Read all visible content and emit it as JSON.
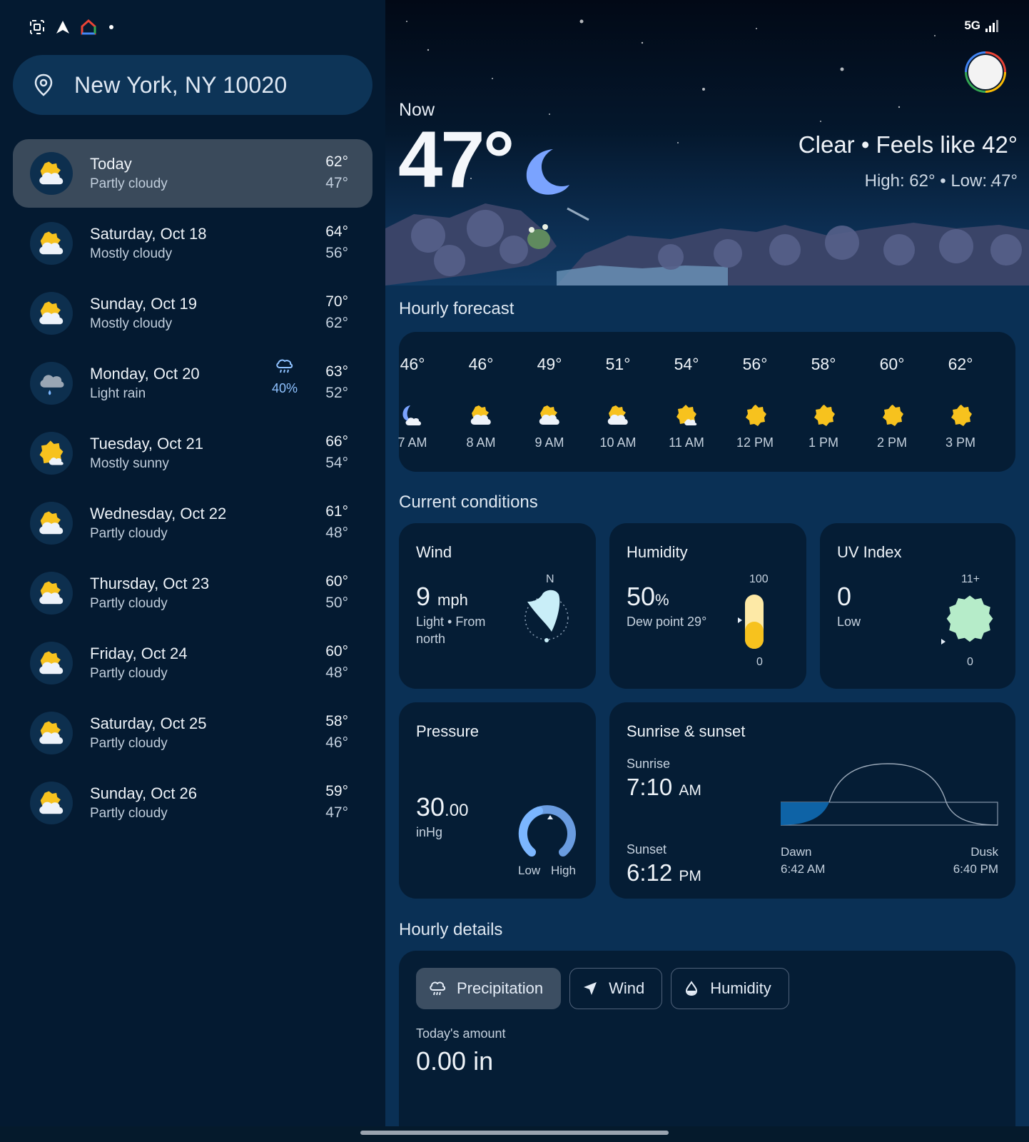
{
  "search": {
    "location": "New York, NY 10020"
  },
  "daily": [
    {
      "name": "Today",
      "cond": "Partly cloudy",
      "hi": "62°",
      "lo": "47°",
      "icon": "partly-cloudy-icon"
    },
    {
      "name": "Saturday, Oct 18",
      "cond": "Mostly cloudy",
      "hi": "64°",
      "lo": "56°",
      "icon": "mostly-cloudy-icon"
    },
    {
      "name": "Sunday, Oct 19",
      "cond": "Mostly cloudy",
      "hi": "70°",
      "lo": "62°",
      "icon": "mostly-cloudy-icon"
    },
    {
      "name": "Monday, Oct 20",
      "cond": "Light rain",
      "hi": "63°",
      "lo": "52°",
      "icon": "light-rain-icon",
      "rain": "40%"
    },
    {
      "name": "Tuesday, Oct 21",
      "cond": "Mostly sunny",
      "hi": "66°",
      "lo": "54°",
      "icon": "mostly-sunny-icon"
    },
    {
      "name": "Wednesday, Oct 22",
      "cond": "Partly cloudy",
      "hi": "61°",
      "lo": "48°",
      "icon": "partly-cloudy-icon"
    },
    {
      "name": "Thursday, Oct 23",
      "cond": "Partly cloudy",
      "hi": "60°",
      "lo": "50°",
      "icon": "partly-cloudy-icon"
    },
    {
      "name": "Friday, Oct 24",
      "cond": "Partly cloudy",
      "hi": "60°",
      "lo": "48°",
      "icon": "partly-cloudy-icon"
    },
    {
      "name": "Saturday, Oct 25",
      "cond": "Partly cloudy",
      "hi": "58°",
      "lo": "46°",
      "icon": "partly-cloudy-icon"
    },
    {
      "name": "Sunday, Oct 26",
      "cond": "Partly cloudy",
      "hi": "59°",
      "lo": "47°",
      "icon": "partly-cloudy-icon"
    }
  ],
  "status": {
    "network": "5G"
  },
  "now": {
    "label": "Now",
    "temp": "47°",
    "cond_line": "Clear • Feels like 42°",
    "hilo_line": "High: 62° • Low: 47°"
  },
  "sections": {
    "hourly": "Hourly forecast",
    "current": "Current conditions",
    "hourly_details": "Hourly details"
  },
  "hourly": [
    {
      "temp": "46°",
      "time": "7 AM",
      "icon": "moon-cloud-icon"
    },
    {
      "temp": "46°",
      "time": "8 AM",
      "icon": "partly-cloudy-icon"
    },
    {
      "temp": "49°",
      "time": "9 AM",
      "icon": "partly-cloudy-icon"
    },
    {
      "temp": "51°",
      "time": "10 AM",
      "icon": "partly-cloudy-icon"
    },
    {
      "temp": "54°",
      "time": "11 AM",
      "icon": "mostly-sunny-icon"
    },
    {
      "temp": "56°",
      "time": "12 PM",
      "icon": "sun-icon"
    },
    {
      "temp": "58°",
      "time": "1 PM",
      "icon": "sun-icon"
    },
    {
      "temp": "60°",
      "time": "2 PM",
      "icon": "sun-icon"
    },
    {
      "temp": "62°",
      "time": "3 PM",
      "icon": "sun-icon"
    }
  ],
  "wind": {
    "title": "Wind",
    "value": "9",
    "unit": "mph",
    "desc1": "Light • From",
    "desc2": "north",
    "dir_label": "N"
  },
  "humidity": {
    "title": "Humidity",
    "value": "50",
    "unit": "%",
    "dew": "Dew point 29°",
    "max": "100",
    "min": "0",
    "level": 0.5
  },
  "uv": {
    "title": "UV Index",
    "value": "0",
    "desc": "Low",
    "max": "11+",
    "min": "0"
  },
  "pressure": {
    "title": "Pressure",
    "value": "30",
    "decimal": ".00",
    "unit": "inHg",
    "low": "Low",
    "high": "High"
  },
  "sun": {
    "title": "Sunrise & sunset",
    "sunrise_label": "Sunrise",
    "sunrise": "7:10",
    "sunrise_ampm": "AM",
    "sunset_label": "Sunset",
    "sunset": "6:12",
    "sunset_ampm": "PM",
    "dawn_label": "Dawn",
    "dawn": "6:42 AM",
    "dusk_label": "Dusk",
    "dusk": "6:40 PM"
  },
  "details": {
    "tabs": [
      "Precipitation",
      "Wind",
      "Humidity"
    ],
    "amount_label": "Today's amount",
    "amount": "0.00 in"
  },
  "colors": {
    "accent_yellow": "#f7c21e",
    "rain_blue": "#8fc2ff",
    "mint": "#b6ecc9",
    "dark_card": "#051d35"
  }
}
